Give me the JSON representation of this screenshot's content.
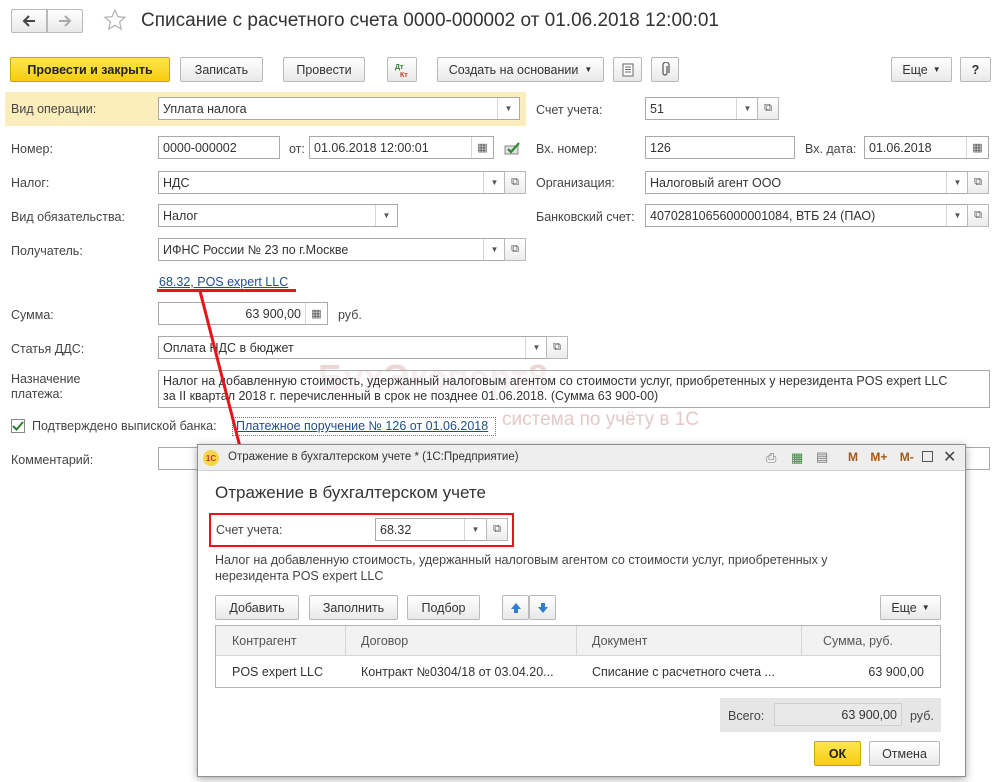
{
  "header": {
    "title": "Списание с расчетного счета 0000-000002 от 01.06.2018 12:00:01",
    "back_icon": "arrow-left-icon",
    "forward_icon": "arrow-right-icon",
    "favorite_icon": "star-icon"
  },
  "toolbar": {
    "post_close": "Провести и закрыть",
    "save": "Записать",
    "post": "Провести",
    "create_based": "Создать на основании",
    "more": "Еще",
    "help": "?"
  },
  "form": {
    "op_type_label": "Вид операции:",
    "op_type_value": "Уплата налога",
    "account_label": "Счет учета:",
    "account_value": "51",
    "number_label": "Номер:",
    "number_value": "0000-000002",
    "from_label": "от:",
    "date_value": "01.06.2018 12:00:01",
    "in_number_label": "Вх. номер:",
    "in_number_value": "126",
    "in_date_label": "Вх. дата:",
    "in_date_value": "01.06.2018",
    "tax_label": "Налог:",
    "tax_value": "НДС",
    "org_label": "Организация:",
    "org_value": "Налоговый агент ООО",
    "liability_label": "Вид обязательства:",
    "liability_value": "Налог",
    "bank_label": "Банковский счет:",
    "bank_value": "40702810656000001084, ВТБ 24 (ПАО)",
    "recipient_label": "Получатель:",
    "recipient_value": "ИФНС России № 23 по г.Москве",
    "link_value": "68.32, POS expert LLC",
    "sum_label": "Сумма:",
    "sum_value": "63 900,00",
    "currency": "руб.",
    "dds_label": "Статья ДДС:",
    "dds_value": "Оплата НДС в бюджет",
    "purpose_label_1": "Назначение",
    "purpose_label_2": "платежа:",
    "purpose_line_1": "Налог на добавленную стоимость, удержанный налоговым агентом со стоимости услуг, приобретенных у нерезидента POS expert LLC",
    "purpose_line_2": "за II квартал 2018 г. перечисленный в срок не позднее 01.06.2018. (Сумма 63 900-00)",
    "confirmed_label": "Подтверждено выпиской банка:",
    "payment_link": "Платежное поручение № 126 от 01.06.2018",
    "comment_label": "Комментарий:"
  },
  "watermark": {
    "brand": "БухЭксперт8",
    "tagline": "система по учёту в 1С"
  },
  "dialog": {
    "window_title": "Отражение в бухгалтерском учете * (1С:Предприятие)",
    "heading": "Отражение в бухгалтерском учете",
    "account_label": "Счет учета:",
    "account_value": "68.32",
    "description_1": "Налог на добавленную стоимость, удержанный налоговым агентом со стоимости услуг, приобретенных у",
    "description_2": "нерезидента POS expert LLC",
    "add": "Добавить",
    "fill": "Заполнить",
    "select": "Подбор",
    "more": "Еще",
    "mem_buttons": [
      "M",
      "M+",
      "M-"
    ],
    "columns": [
      "Контрагент",
      "Договор",
      "Документ",
      "Сумма, руб."
    ],
    "rows": [
      [
        "POS expert LLC",
        "Контракт №0304/18 от 03.04.20...",
        "Списание с расчетного счета ...",
        "63 900,00"
      ]
    ],
    "total_label": "Всего:",
    "total_value": "63 900,00",
    "total_currency": "руб.",
    "ok": "ОК",
    "cancel": "Отмена"
  },
  "colors": {
    "accent_yellow": "#f6cc0e",
    "highlight_bg": "#fbeebc",
    "annotation_red": "#e8141b",
    "link_blue": "#1f4e8c"
  }
}
